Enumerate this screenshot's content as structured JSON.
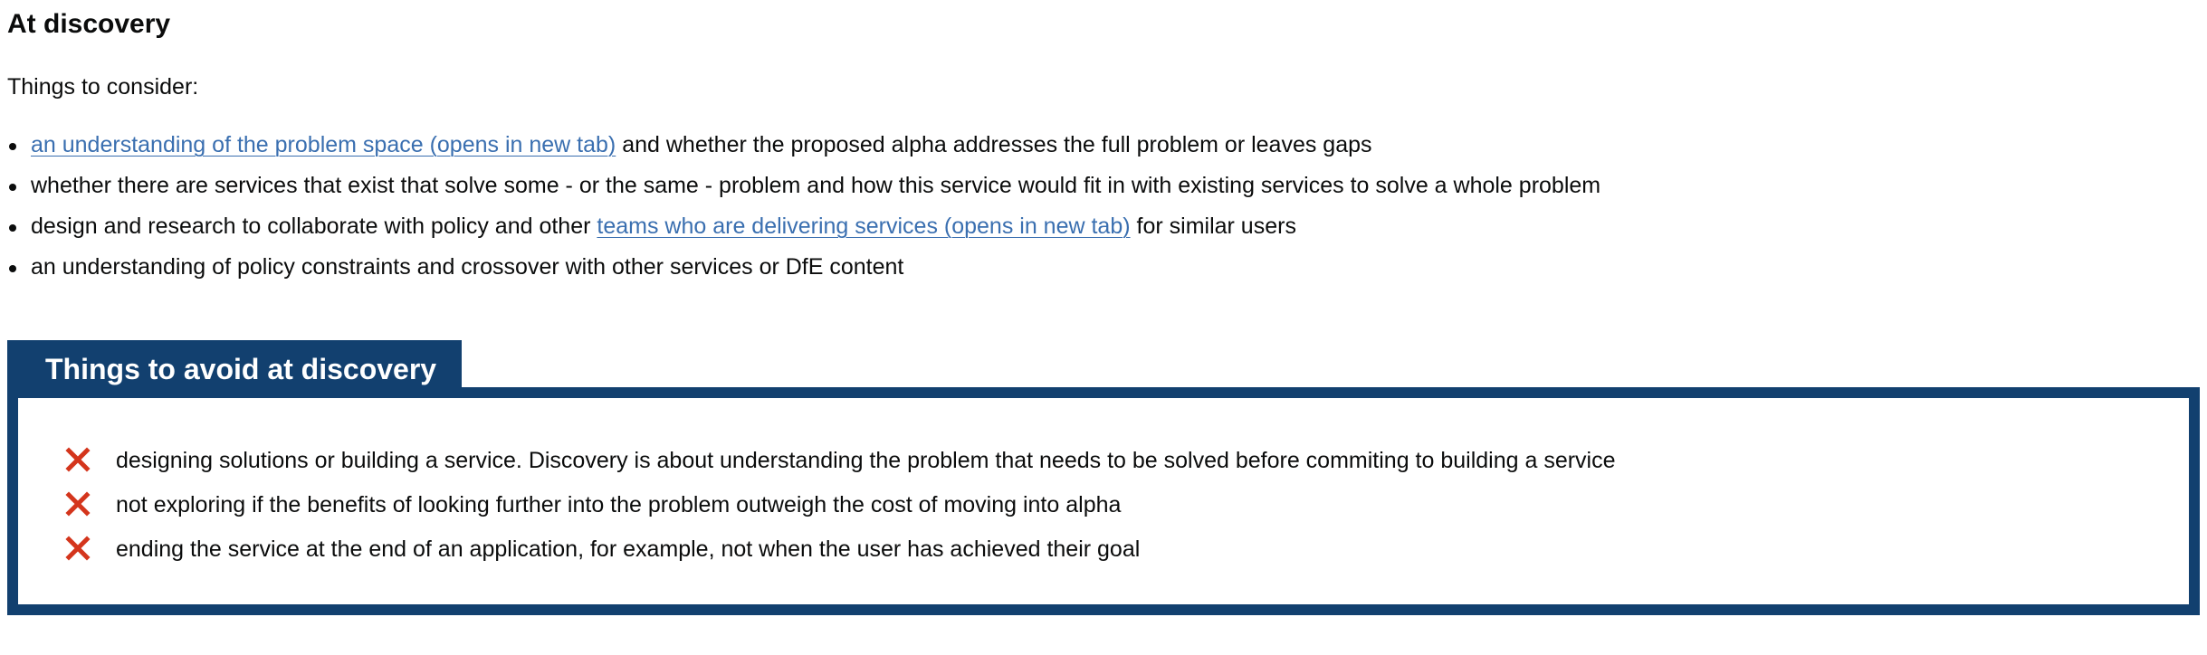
{
  "section": {
    "heading": "At discovery",
    "intro": "Things to consider:"
  },
  "consider": {
    "items": [
      {
        "link_text": "an understanding of the problem space (opens in new tab)",
        "after_text": " and whether the proposed alpha addresses the full problem or leaves gaps"
      },
      {
        "text": "whether there are services that exist that solve some - or the same - problem and how this service would fit in with existing services to solve a whole problem"
      },
      {
        "before_text": "design and research to collaborate with policy and other ",
        "link_text": "teams who are delivering services (opens in new tab)",
        "after_text": " for similar users"
      },
      {
        "text": "an understanding of policy constraints and crossover with other services or DfE content"
      }
    ]
  },
  "avoid": {
    "title": "Things to avoid at discovery",
    "icon": "cross-icon",
    "icon_color": "#d4351c",
    "accent_color": "#12406f",
    "items": [
      "designing solutions or building a service. Discovery is about understanding the problem that needs to be solved before commiting to building a service",
      "not exploring if the benefits of looking further into the problem outweigh the cost of moving into alpha",
      "ending the service at the end of an application, for example, not when the user has achieved their goal"
    ]
  }
}
